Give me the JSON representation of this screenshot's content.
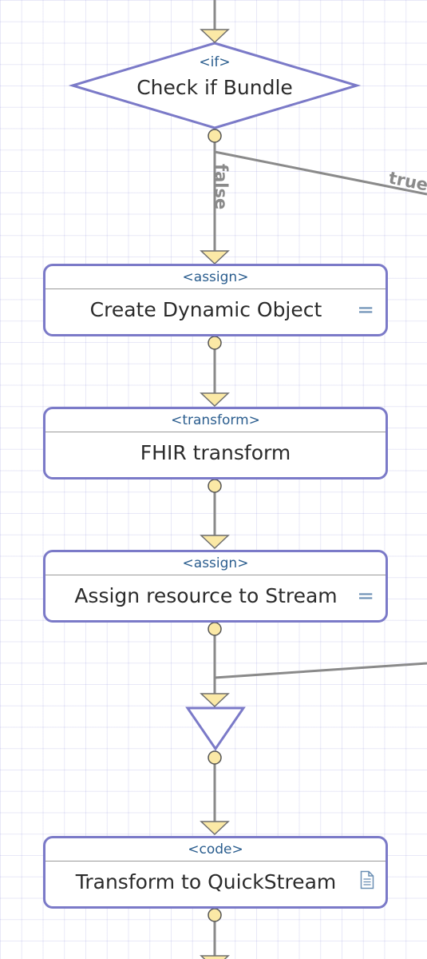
{
  "diagram": {
    "if_node": {
      "tag": "<if>",
      "label": "Check if Bundle"
    },
    "branch_false_label": "false",
    "branch_true_label": "true",
    "steps": [
      {
        "id": "create-dynamic-object",
        "tag": "<assign>",
        "label": "Create Dynamic Object",
        "badge": "="
      },
      {
        "id": "fhir-transform",
        "tag": "<transform>",
        "label": "FHIR transform"
      },
      {
        "id": "assign-resource-to-stream",
        "tag": "<assign>",
        "label": "Assign resource to Stream",
        "badge": "="
      },
      {
        "id": "transform-to-quickstream",
        "tag": "<code>",
        "label": "Transform to QuickStream",
        "badge_icon": "document-icon"
      }
    ],
    "colors": {
      "node_border": "#7b7ac8",
      "connector_line": "#8a8a8a",
      "port_fill": "#fbe9a6",
      "port_stroke": "#555555",
      "tag_text": "#2a5d8e",
      "label_text": "#2b2b2b",
      "badge": "#6b8fb4",
      "grid": "#d8d8f2"
    }
  }
}
